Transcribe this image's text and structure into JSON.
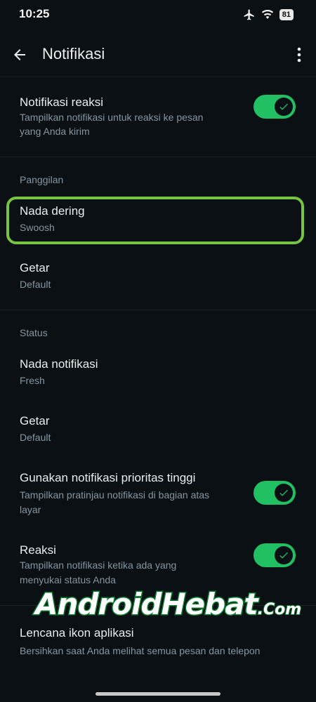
{
  "status_bar": {
    "time": "10:25",
    "battery": "81",
    "icons": [
      "airplane-icon",
      "wifi-icon",
      "battery-icon"
    ]
  },
  "app_bar": {
    "title": "Notifikasi",
    "back_icon": "arrow-left-icon",
    "more_icon": "more-vertical-icon"
  },
  "reactions": {
    "title": "Notifikasi reaksi",
    "subtitle_line1": "Tampilkan notifikasi untuk reaksi ke pesan",
    "subtitle_line2": "yang Anda kirim",
    "enabled": true
  },
  "calls": {
    "section": "Panggilan",
    "ringtone": {
      "title": "Nada dering",
      "value": "Swoosh"
    },
    "vibrate": {
      "title": "Getar",
      "value": "Default"
    }
  },
  "status": {
    "section": "Status",
    "tone": {
      "title": "Nada notifikasi",
      "value": "Fresh"
    },
    "vibrate": {
      "title": "Getar",
      "value": "Default"
    },
    "high_priority": {
      "title": "Gunakan notifikasi prioritas tinggi",
      "subtitle_line1": "Tampilkan pratinjau notifikasi di bagian atas",
      "subtitle_line2": "layar",
      "enabled": true
    },
    "reactions": {
      "title": "Reaksi",
      "subtitle_line1": "Tampilkan notifikasi ketika ada yang",
      "subtitle_line2": "menyukai status Anda",
      "enabled": true
    }
  },
  "badge": {
    "title": "Lencana ikon aplikasi",
    "subtitle": "Bersihkan saat Anda melihat semua pesan dan telepon"
  },
  "watermark": {
    "main": "AndroidHebat",
    "suffix": ".Com"
  },
  "colors": {
    "background": "#0b1014",
    "accent": "#21c063",
    "highlight": "#76c442",
    "secondary_text": "#8696a0"
  }
}
